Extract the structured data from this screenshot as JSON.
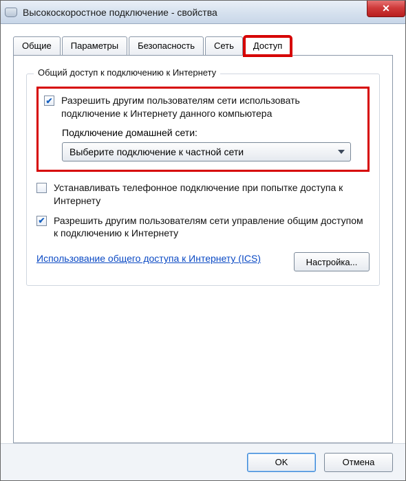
{
  "window": {
    "title": "Высокоскоростное подключение - свойства"
  },
  "tabs": [
    {
      "label": "Общие",
      "active": false
    },
    {
      "label": "Параметры",
      "active": false
    },
    {
      "label": "Безопасность",
      "active": false
    },
    {
      "label": "Сеть",
      "active": false
    },
    {
      "label": "Доступ",
      "active": true
    }
  ],
  "group": {
    "title": "Общий доступ к подключению к Интернету",
    "allow_share": {
      "checked": true,
      "label": "Разрешить другим пользователям сети использовать подключение к Интернету данного компьютера",
      "home_net_label": "Подключение домашней сети:",
      "combo_value": "Выберите подключение к частной сети"
    },
    "dial": {
      "checked": false,
      "label": "Устанавливать телефонное подключение при попытке доступа к Интернету"
    },
    "allow_control": {
      "checked": true,
      "label": "Разрешить другим пользователям сети управление общим доступом к подключению к Интернету"
    },
    "link": "Использование общего доступа к Интернету (ICS)",
    "settings_btn": "Настройка..."
  },
  "footer": {
    "ok": "OK",
    "cancel": "Отмена"
  }
}
